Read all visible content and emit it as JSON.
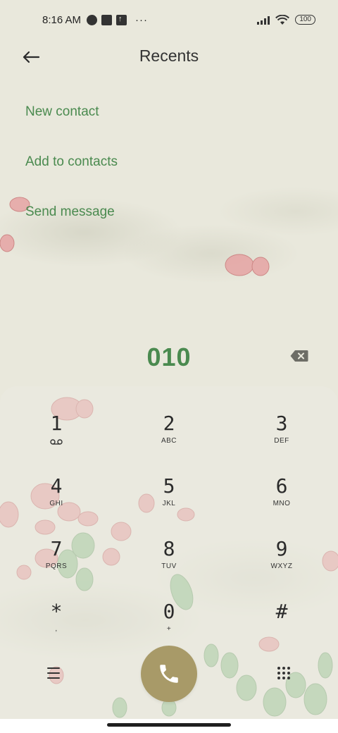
{
  "status_bar": {
    "time": "8:16 AM",
    "overflow": "···",
    "battery": "100"
  },
  "header": {
    "title": "Recents"
  },
  "actions": {
    "new_contact": "New contact",
    "add_to_contacts": "Add to contacts",
    "send_message": "Send message"
  },
  "dialer": {
    "number": "010"
  },
  "keypad": [
    {
      "digit": "1",
      "letters": ""
    },
    {
      "digit": "2",
      "letters": "ABC"
    },
    {
      "digit": "3",
      "letters": "DEF"
    },
    {
      "digit": "4",
      "letters": "GHI"
    },
    {
      "digit": "5",
      "letters": "JKL"
    },
    {
      "digit": "6",
      "letters": "MNO"
    },
    {
      "digit": "7",
      "letters": "PQRS"
    },
    {
      "digit": "8",
      "letters": "TUV"
    },
    {
      "digit": "9",
      "letters": "WXYZ"
    },
    {
      "digit": "*",
      "letters": ","
    },
    {
      "digit": "0",
      "letters": "+"
    },
    {
      "digit": "#",
      "letters": ""
    }
  ],
  "icons": {
    "back": "arrow-left-icon",
    "backspace": "backspace-icon",
    "voicemail": "voicemail-icon",
    "menu": "menu-icon",
    "call": "phone-icon",
    "dialpad": "dialpad-icon"
  },
  "colors": {
    "background": "#e9e8dc",
    "accent_green": "#4a8a4f",
    "call_button": "#a89a68"
  }
}
